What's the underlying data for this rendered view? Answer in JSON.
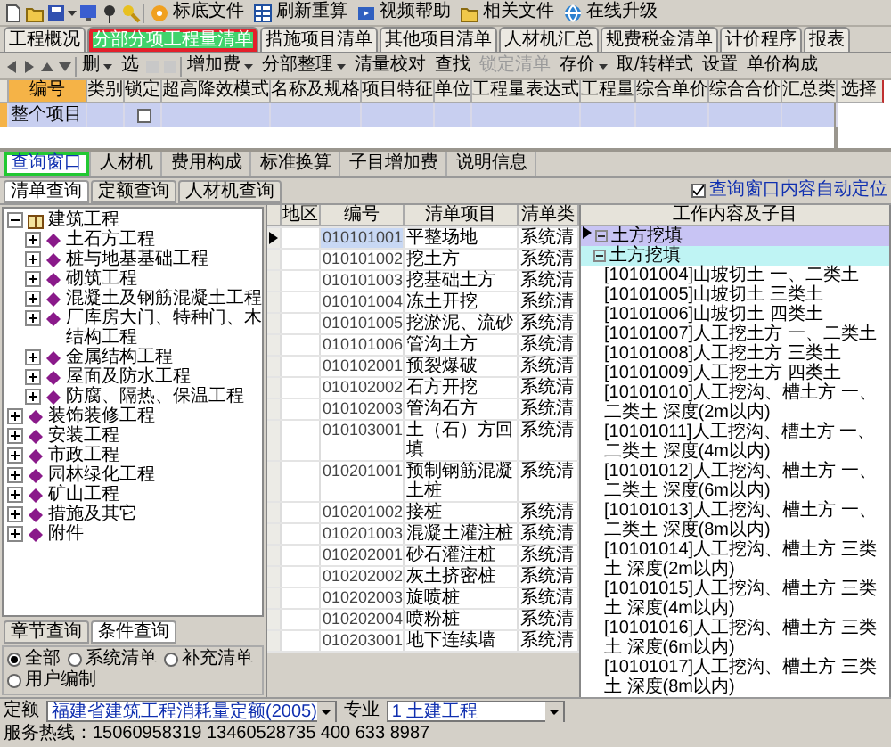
{
  "toolbar": {
    "buttons": [
      {
        "label": "标底文件"
      },
      {
        "label": "刷新重算"
      },
      {
        "label": "视频帮助"
      },
      {
        "label": "相关文件"
      },
      {
        "label": "在线升级"
      }
    ]
  },
  "tabs": [
    {
      "label": "工程概况",
      "selected": false,
      "highlighted": false
    },
    {
      "label": "分部分项工程量清单",
      "selected": true,
      "highlighted": true
    },
    {
      "label": "措施项目清单",
      "selected": false,
      "highlighted": false
    },
    {
      "label": "其他项目清单",
      "selected": false,
      "highlighted": false
    },
    {
      "label": "人材机汇总",
      "selected": false,
      "highlighted": false
    },
    {
      "label": "规费税金清单",
      "selected": false,
      "highlighted": false
    },
    {
      "label": "计价程序",
      "selected": false,
      "highlighted": false
    },
    {
      "label": "报表",
      "selected": false,
      "highlighted": false
    }
  ],
  "edit_toolbar": [
    {
      "label": "删",
      "dropdown": true,
      "disabled": false
    },
    {
      "label": "选",
      "dropdown": false,
      "disabled": false
    },
    {
      "label": "增加费",
      "dropdown": true,
      "disabled": false
    },
    {
      "label": "分部整理",
      "dropdown": true,
      "disabled": false
    },
    {
      "label": "清量校对",
      "dropdown": false,
      "disabled": false
    },
    {
      "label": "查找",
      "dropdown": false,
      "disabled": false
    },
    {
      "label": "锁定清单",
      "dropdown": false,
      "disabled": true
    },
    {
      "label": "存价",
      "dropdown": true,
      "disabled": false
    },
    {
      "label": "取/转样式",
      "dropdown": false,
      "disabled": false
    },
    {
      "label": "设置",
      "dropdown": false,
      "disabled": false
    },
    {
      "label": "单价构成",
      "dropdown": false,
      "disabled": false
    }
  ],
  "grid": {
    "columns": [
      "编号",
      "类别",
      "锁定",
      "超高降效模式",
      "名称及规格",
      "项目特征",
      "单位",
      "工程量表达式",
      "工程量",
      "综合单价",
      "综合合价",
      "汇总类"
    ],
    "rows": [
      {
        "code": "整个项目",
        "locked": false,
        "selected": true
      }
    ]
  },
  "side_panel": {
    "columns": [
      "选择"
    ]
  },
  "bottom_tabs": [
    {
      "label": "查询窗口",
      "selected": true,
      "highlighted": true
    },
    {
      "label": "人材机",
      "selected": false,
      "highlighted": false
    },
    {
      "label": "费用构成",
      "selected": false,
      "highlighted": false
    },
    {
      "label": "标准换算",
      "selected": false,
      "highlighted": false
    },
    {
      "label": "子目增加费",
      "selected": false,
      "highlighted": false
    },
    {
      "label": "说明信息",
      "selected": false,
      "highlighted": false
    }
  ],
  "query_tabs": [
    {
      "label": "清单查询",
      "selected": true
    },
    {
      "label": "定额查询",
      "selected": false
    },
    {
      "label": "人材机查询",
      "selected": false
    }
  ],
  "auto_locate": {
    "label": "查询窗口内容自动定位",
    "checked": true
  },
  "chapter_tree": [
    {
      "label": "建筑工程",
      "expanded": true,
      "children": [
        {
          "label": "土石方工程",
          "expanded": false
        },
        {
          "label": "桩与地基基础工程",
          "expanded": false
        },
        {
          "label": "砌筑工程",
          "expanded": false
        },
        {
          "label": "混凝土及钢筋混凝土工程",
          "expanded": false
        },
        {
          "label": "厂库房大门、特种门、木结构工程",
          "expanded": false
        },
        {
          "label": "金属结构工程",
          "expanded": false
        },
        {
          "label": "屋面及防水工程",
          "expanded": false
        },
        {
          "label": "防腐、隔热、保温工程",
          "expanded": false
        }
      ]
    },
    {
      "label": "装饰装修工程",
      "expanded": false
    },
    {
      "label": "安装工程",
      "expanded": false
    },
    {
      "label": "市政工程",
      "expanded": false
    },
    {
      "label": "园林绿化工程",
      "expanded": false
    },
    {
      "label": "矿山工程",
      "expanded": false
    },
    {
      "label": "措施及其它",
      "expanded": false
    },
    {
      "label": "附件",
      "expanded": false
    }
  ],
  "search_mode_tabs": [
    {
      "label": "章节查询",
      "selected": false
    },
    {
      "label": "条件查询",
      "selected": true
    }
  ],
  "filters": [
    {
      "label": "全部",
      "selected": true
    },
    {
      "label": "系统清单",
      "selected": false
    },
    {
      "label": "补充清单",
      "selected": false
    },
    {
      "label": "用户编制",
      "selected": false
    }
  ],
  "bill_table": {
    "columns": [
      "地区",
      "编号",
      "清单项目",
      "清单类"
    ],
    "rows": [
      {
        "code": "010101001",
        "name": "平整场地",
        "type": "系统清",
        "selected": true
      },
      {
        "code": "010101002",
        "name": "挖土方",
        "type": "系统清",
        "selected": false
      },
      {
        "code": "010101003",
        "name": "挖基础土方",
        "type": "系统清",
        "selected": false
      },
      {
        "code": "010101004",
        "name": "冻土开挖",
        "type": "系统清",
        "selected": false
      },
      {
        "code": "010101005",
        "name": "挖淤泥、流砂",
        "type": "系统清",
        "selected": false
      },
      {
        "code": "010101006",
        "name": "管沟土方",
        "type": "系统清",
        "selected": false
      },
      {
        "code": "010102001",
        "name": "预裂爆破",
        "type": "系统清",
        "selected": false
      },
      {
        "code": "010102002",
        "name": "石方开挖",
        "type": "系统清",
        "selected": false
      },
      {
        "code": "010102003",
        "name": "管沟石方",
        "type": "系统清",
        "selected": false
      },
      {
        "code": "010103001",
        "name": "土（石）方回填",
        "type": "系统清",
        "selected": false
      },
      {
        "code": "010201001",
        "name": "预制钢筋混凝土桩",
        "type": "系统清",
        "selected": false
      },
      {
        "code": "010201002",
        "name": "接桩",
        "type": "系统清",
        "selected": false
      },
      {
        "code": "010201003",
        "name": "混凝土灌注桩",
        "type": "系统清",
        "selected": false
      },
      {
        "code": "010202001",
        "name": "砂石灌注桩",
        "type": "系统清",
        "selected": false
      },
      {
        "code": "010202002",
        "name": "灰土挤密桩",
        "type": "系统清",
        "selected": false
      },
      {
        "code": "010202003",
        "name": "旋喷桩",
        "type": "系统清",
        "selected": false
      },
      {
        "code": "010202004",
        "name": "喷粉桩",
        "type": "系统清",
        "selected": false
      },
      {
        "code": "010203001",
        "name": "地下连续墙",
        "type": "系统清",
        "selected": false
      }
    ]
  },
  "work_tree": {
    "title": "工作内容及子目",
    "items": [
      {
        "label": "土方挖填",
        "expanded": true,
        "selected": true,
        "children": [
          {
            "label": "土方挖填",
            "expanded": true,
            "children": [
              {
                "label": "[10101004]山坡切土 一、二类土"
              },
              {
                "label": "[10101005]山坡切土 三类土"
              },
              {
                "label": "[10101006]山坡切土 四类土"
              },
              {
                "label": "[10101007]人工挖土方 一、二类土"
              },
              {
                "label": "[10101008]人工挖土方 三类土"
              },
              {
                "label": "[10101009]人工挖土方 四类土"
              },
              {
                "label": "[10101010]人工挖沟、槽土方 一、二类土 深度(2m以内)"
              },
              {
                "label": "[10101011]人工挖沟、槽土方 一、二类土 深度(4m以内)"
              },
              {
                "label": "[10101012]人工挖沟、槽土方 一、二类土 深度(6m以内)"
              },
              {
                "label": "[10101013]人工挖沟、槽土方 一、二类土 深度(8m以内)"
              },
              {
                "label": "[10101014]人工挖沟、槽土方 三类土 深度(2m以内)"
              },
              {
                "label": "[10101015]人工挖沟、槽土方 三类土 深度(4m以内)"
              },
              {
                "label": "[10101016]人工挖沟、槽土方 三类土 深度(6m以内)"
              },
              {
                "label": "[10101017]人工挖沟、槽土方 三类土 深度(8m以内)"
              }
            ]
          }
        ]
      }
    ]
  },
  "status_bar": {
    "quota_label": "定额",
    "quota": "福建省建筑工程消耗量定额(2005)",
    "major_label": "专业",
    "major": "1 土建工程",
    "hotline": "服务热线：15060958319 13460528735 400 633 8987"
  }
}
